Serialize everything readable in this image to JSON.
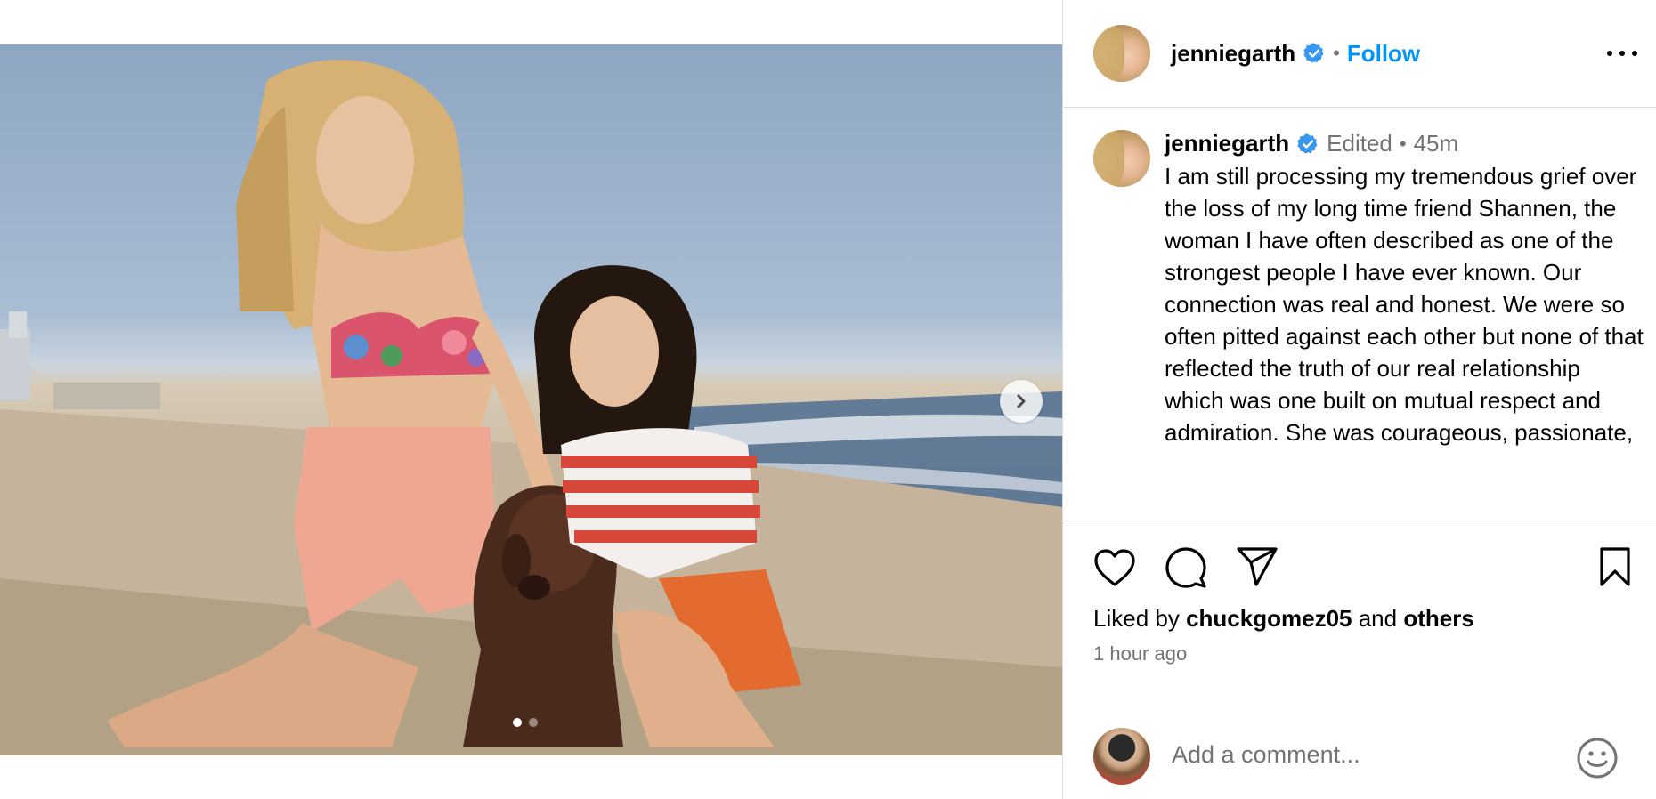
{
  "post": {
    "username": "jenniegarth",
    "follow_label": "Follow",
    "separator": "•",
    "carousel": {
      "total": 2,
      "current": 1
    },
    "photo_alt": ""
  },
  "caption": {
    "username": "jenniegarth",
    "edited_label": "Edited",
    "separator": "•",
    "time": "45m",
    "text": "I am still processing my tremendous grief over the loss of my long time friend Shannen, the woman I have often described as one of the strongest people I have ever known. Our connection was real and honest. We were so often pitted against each other but none of that reflected the truth of our real relationship which was one built on mutual respect and admiration. She was courageous, passionate,"
  },
  "engagement": {
    "liked_prefix": "Liked by",
    "liked_user": "chuckgomez05",
    "liked_and": "and",
    "liked_others": "others",
    "posted_ago": "1 hour ago"
  },
  "comment": {
    "placeholder": "Add a comment..."
  },
  "icons": {
    "verified": "verified-badge-icon",
    "more": "more-options-icon",
    "like": "heart-icon",
    "comment": "comment-icon",
    "share": "paper-plane-icon",
    "save": "bookmark-icon",
    "emoji": "emoji-icon",
    "next": "chevron-right-icon"
  },
  "colors": {
    "link_blue": "#0095f6",
    "verified_blue": "#3897f0",
    "muted": "#737373",
    "divider": "#dbdbdb"
  }
}
